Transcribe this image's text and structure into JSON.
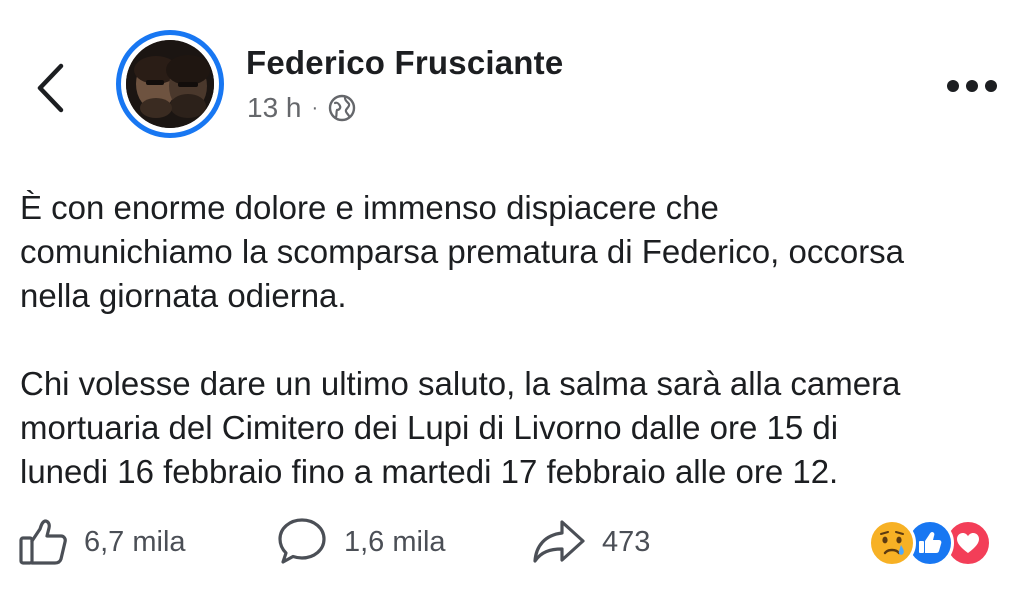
{
  "header": {
    "author": "Federico Frusciante",
    "time": "13 h",
    "separator": "·",
    "audience_icon": "globe-icon"
  },
  "post": {
    "paragraphs": [
      "È con enorme dolore e immenso dispiacere che\ncomunichiamo la scomparsa prematura di Federico, occorsa\nnella giornata odierna.",
      "Chi volesse dare un ultimo saluto, la salma sarà alla camera\nmortuaria del Cimitero dei Lupi di Livorno dalle ore 15 di\nlunedi 16 febbraio fino a martedi 17 febbraio alle ore 12."
    ]
  },
  "footer": {
    "likes": "6,7 mila",
    "comments": "1,6 mila",
    "shares": "473",
    "reactions": [
      "sad-reaction-icon",
      "like-reaction-icon",
      "love-reaction-icon"
    ]
  },
  "colors": {
    "accent": "#1877f2",
    "love": "#f33e58",
    "sad": "#f7b125",
    "text": "#1c1e21",
    "secondary": "#65676b"
  }
}
